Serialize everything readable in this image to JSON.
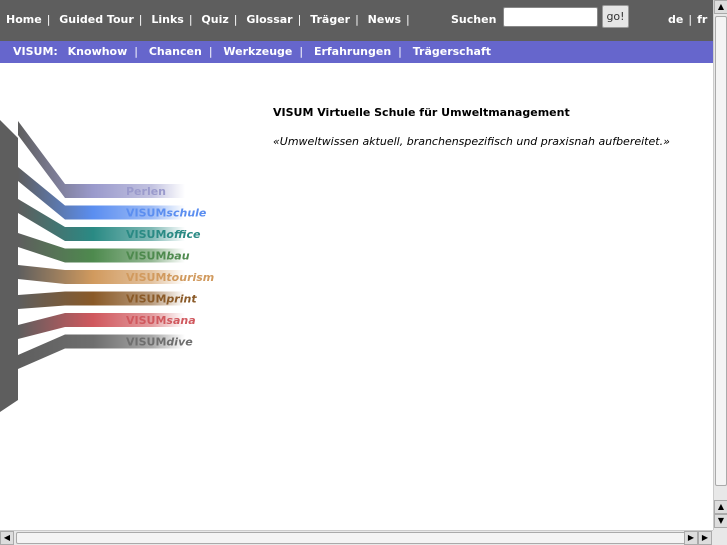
{
  "topnav": {
    "items": [
      "Home",
      "Guided Tour",
      "Links",
      "Quiz",
      "Glossar",
      "Träger",
      "News"
    ],
    "search_label": "Suchen",
    "search_value": "",
    "search_button": "go!",
    "lang": [
      "de",
      "fr"
    ]
  },
  "subnav": {
    "prefix": "VISUM:",
    "items": [
      "Knowhow",
      "Chancen",
      "Werkzeuge",
      "Erfahrungen",
      "Trägerschaft"
    ]
  },
  "main": {
    "title": "VISUM Virtuelle Schule für Umweltmanagement",
    "tagline": "«Umweltwissen aktuell, branchenspezifisch und praxisnah aufbereitet.»"
  },
  "graphic": {
    "items": [
      {
        "prefix": "",
        "suffix": "Perlen",
        "color": "#9a9acc"
      },
      {
        "prefix": "VISUM",
        "suffix": "schule",
        "color": "#5b8ef0"
      },
      {
        "prefix": "VISUM",
        "suffix": "office",
        "color": "#2a8a84"
      },
      {
        "prefix": "VISUM",
        "suffix": "bau",
        "color": "#4e8a4e"
      },
      {
        "prefix": "VISUM",
        "suffix": "tourism",
        "color": "#d19a5e"
      },
      {
        "prefix": "VISUM",
        "suffix": "print",
        "color": "#8a5a28"
      },
      {
        "prefix": "VISUM",
        "suffix": "sana",
        "color": "#d0585e"
      },
      {
        "prefix": "VISUM",
        "suffix": "dive",
        "color": "#6e6e6e"
      }
    ]
  }
}
